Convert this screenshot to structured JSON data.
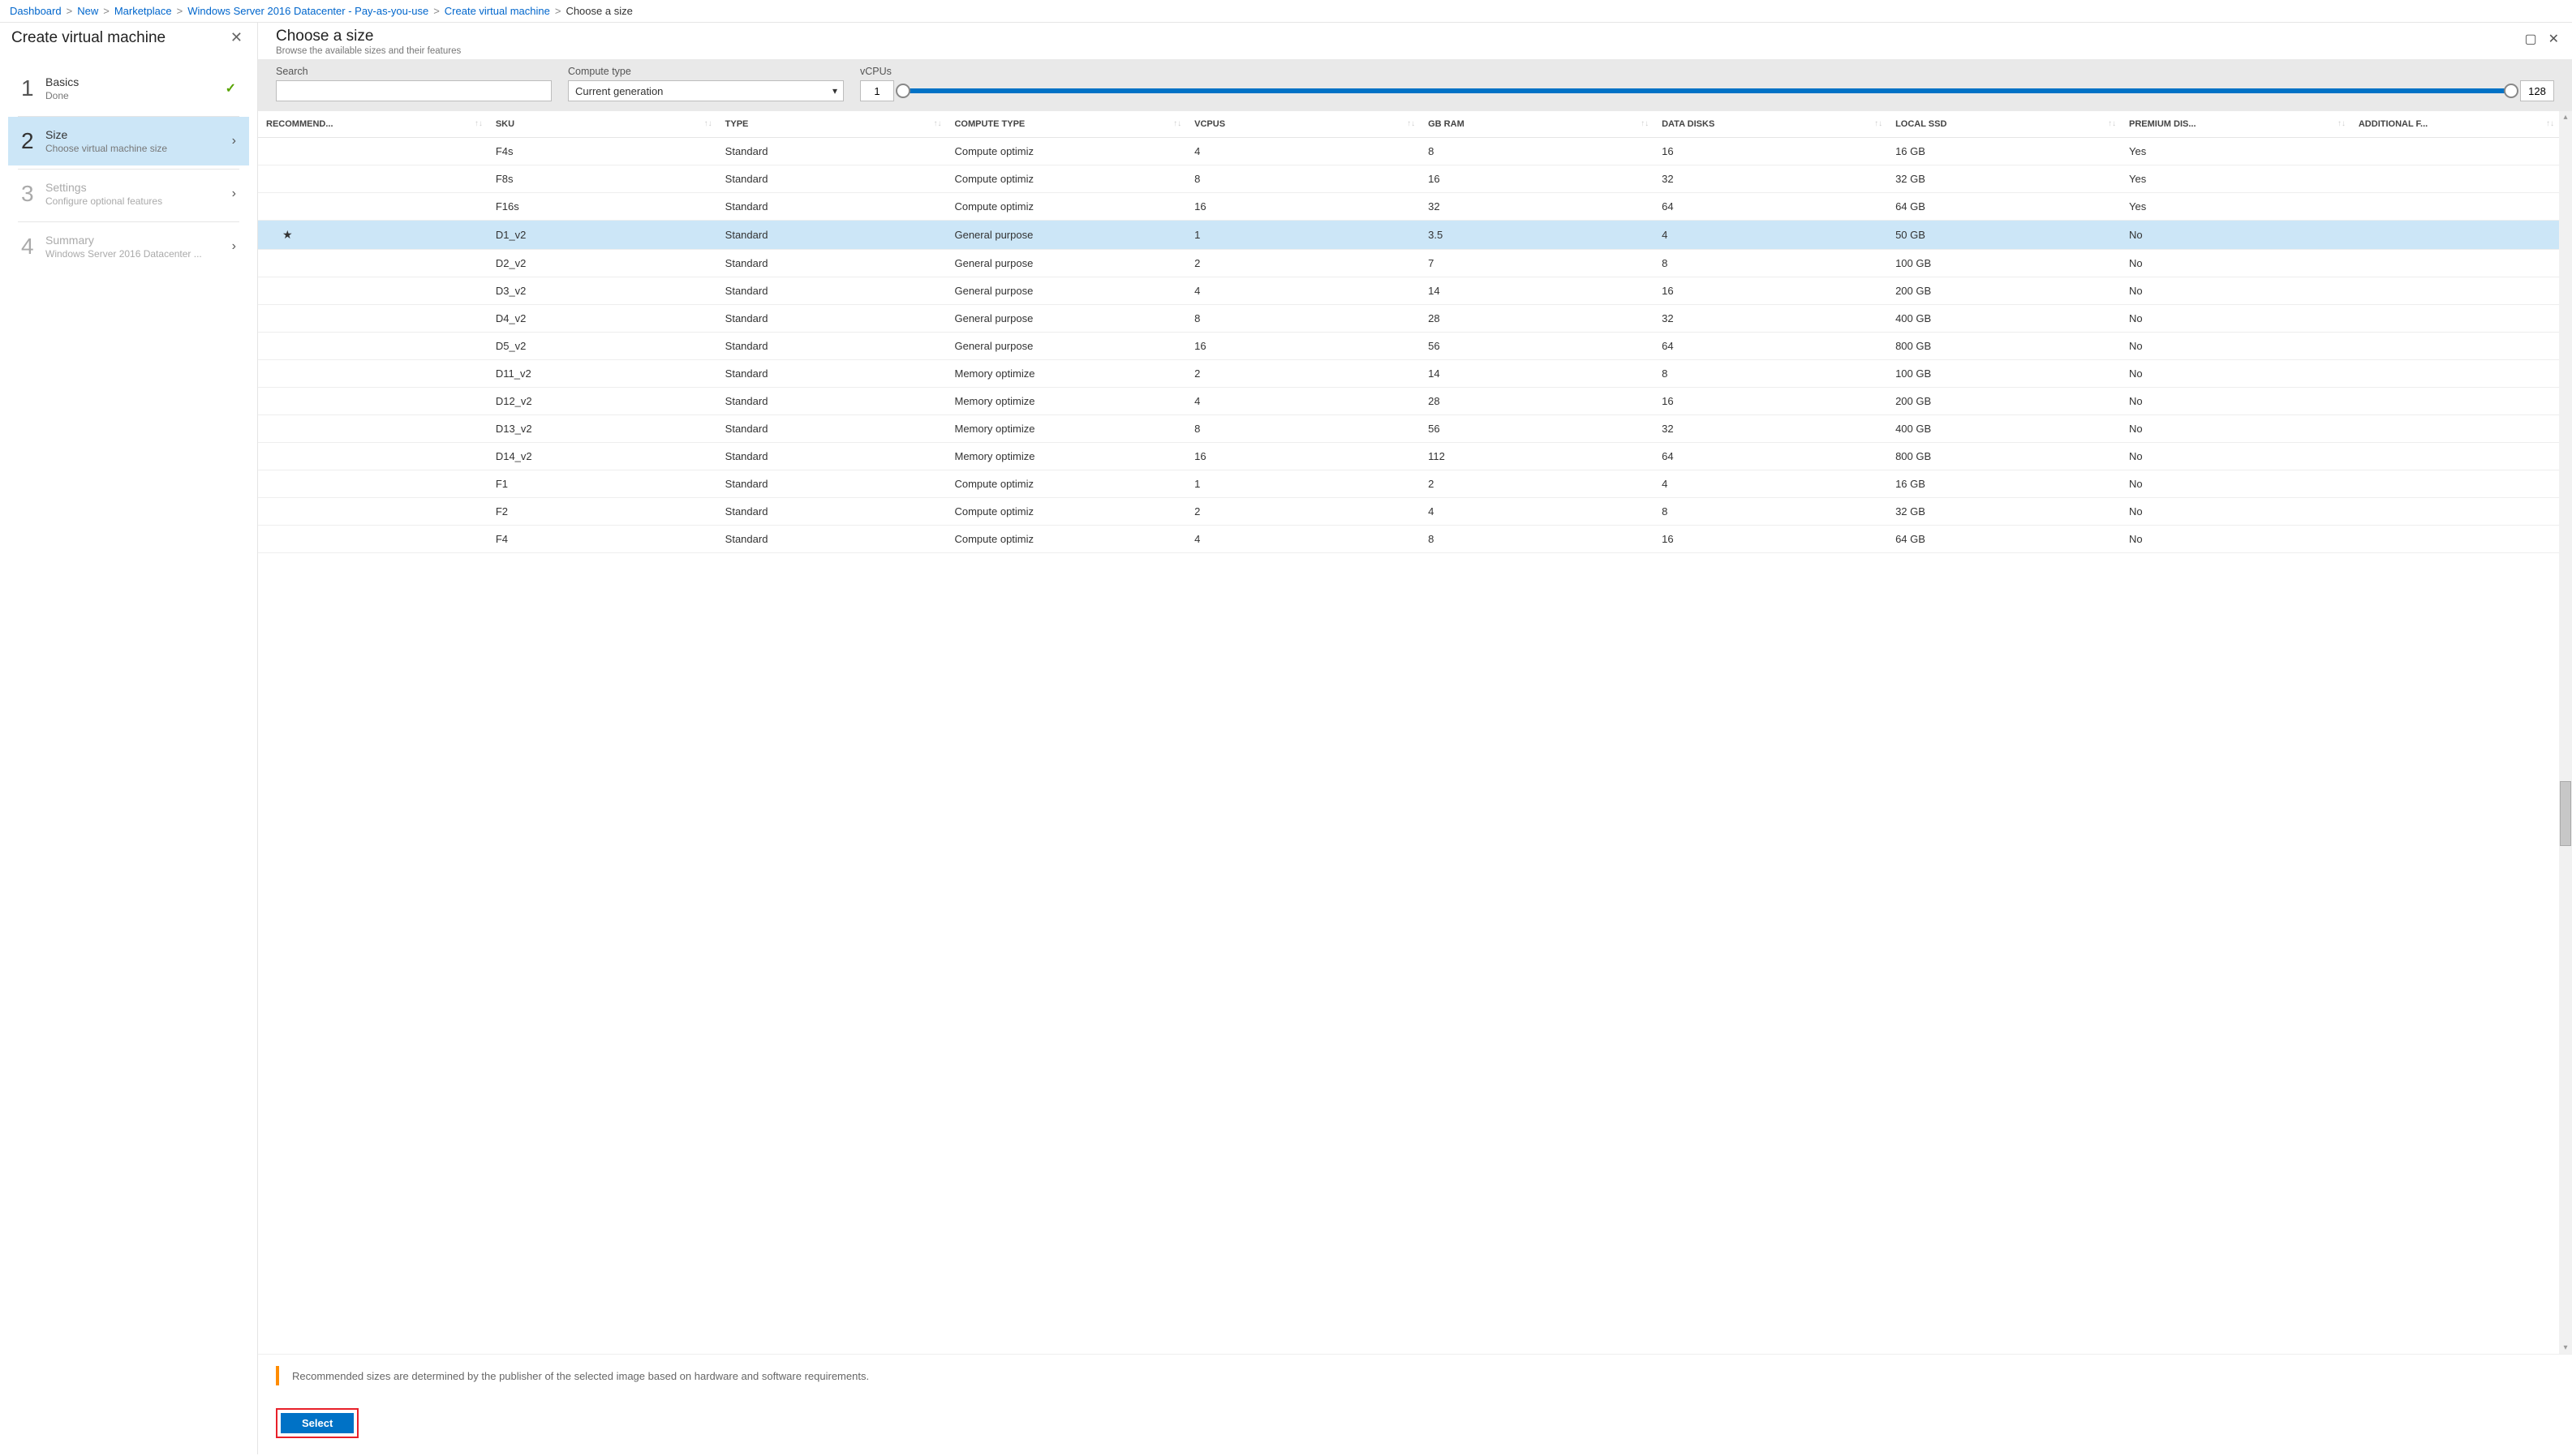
{
  "breadcrumb": {
    "items": [
      "Dashboard",
      "New",
      "Marketplace",
      "Windows Server 2016 Datacenter - Pay-as-you-use",
      "Create virtual machine"
    ],
    "current": "Choose a size"
  },
  "leftBlade": {
    "title": "Create virtual machine",
    "steps": [
      {
        "num": "1",
        "title": "Basics",
        "sub": "Done",
        "state": "done"
      },
      {
        "num": "2",
        "title": "Size",
        "sub": "Choose virtual machine size",
        "state": "active"
      },
      {
        "num": "3",
        "title": "Settings",
        "sub": "Configure optional features",
        "state": "disabled"
      },
      {
        "num": "4",
        "title": "Summary",
        "sub": "Windows Server 2016 Datacenter ...",
        "state": "disabled"
      }
    ]
  },
  "rightBlade": {
    "title": "Choose a size",
    "subtitle": "Browse the available sizes and their features",
    "filters": {
      "searchLabel": "Search",
      "searchValue": "",
      "computeTypeLabel": "Compute type",
      "computeTypeValue": "Current generation",
      "vcpusLabel": "vCPUs",
      "vcpusMin": "1",
      "vcpusMax": "128"
    },
    "columns": [
      "RECOMMEND...",
      "SKU",
      "TYPE",
      "COMPUTE TYPE",
      "VCPUS",
      "GB RAM",
      "DATA DISKS",
      "LOCAL SSD",
      "PREMIUM DIS...",
      "ADDITIONAL F..."
    ],
    "rows": [
      {
        "rec": "",
        "sku": "F4s",
        "type": "Standard",
        "ct": "Compute optimiz",
        "vcpus": "4",
        "ram": "8",
        "dd": "16",
        "ssd": "16 GB",
        "prem": "Yes"
      },
      {
        "rec": "",
        "sku": "F8s",
        "type": "Standard",
        "ct": "Compute optimiz",
        "vcpus": "8",
        "ram": "16",
        "dd": "32",
        "ssd": "32 GB",
        "prem": "Yes"
      },
      {
        "rec": "",
        "sku": "F16s",
        "type": "Standard",
        "ct": "Compute optimiz",
        "vcpus": "16",
        "ram": "32",
        "dd": "64",
        "ssd": "64 GB",
        "prem": "Yes"
      },
      {
        "rec": "★",
        "sku": "D1_v2",
        "type": "Standard",
        "ct": "General purpose",
        "vcpus": "1",
        "ram": "3.5",
        "dd": "4",
        "ssd": "50 GB",
        "prem": "No",
        "selected": true
      },
      {
        "rec": "",
        "sku": "D2_v2",
        "type": "Standard",
        "ct": "General purpose",
        "vcpus": "2",
        "ram": "7",
        "dd": "8",
        "ssd": "100 GB",
        "prem": "No"
      },
      {
        "rec": "",
        "sku": "D3_v2",
        "type": "Standard",
        "ct": "General purpose",
        "vcpus": "4",
        "ram": "14",
        "dd": "16",
        "ssd": "200 GB",
        "prem": "No"
      },
      {
        "rec": "",
        "sku": "D4_v2",
        "type": "Standard",
        "ct": "General purpose",
        "vcpus": "8",
        "ram": "28",
        "dd": "32",
        "ssd": "400 GB",
        "prem": "No"
      },
      {
        "rec": "",
        "sku": "D5_v2",
        "type": "Standard",
        "ct": "General purpose",
        "vcpus": "16",
        "ram": "56",
        "dd": "64",
        "ssd": "800 GB",
        "prem": "No"
      },
      {
        "rec": "",
        "sku": "D11_v2",
        "type": "Standard",
        "ct": "Memory optimize",
        "vcpus": "2",
        "ram": "14",
        "dd": "8",
        "ssd": "100 GB",
        "prem": "No"
      },
      {
        "rec": "",
        "sku": "D12_v2",
        "type": "Standard",
        "ct": "Memory optimize",
        "vcpus": "4",
        "ram": "28",
        "dd": "16",
        "ssd": "200 GB",
        "prem": "No"
      },
      {
        "rec": "",
        "sku": "D13_v2",
        "type": "Standard",
        "ct": "Memory optimize",
        "vcpus": "8",
        "ram": "56",
        "dd": "32",
        "ssd": "400 GB",
        "prem": "No"
      },
      {
        "rec": "",
        "sku": "D14_v2",
        "type": "Standard",
        "ct": "Memory optimize",
        "vcpus": "16",
        "ram": "112",
        "dd": "64",
        "ssd": "800 GB",
        "prem": "No"
      },
      {
        "rec": "",
        "sku": "F1",
        "type": "Standard",
        "ct": "Compute optimiz",
        "vcpus": "1",
        "ram": "2",
        "dd": "4",
        "ssd": "16 GB",
        "prem": "No"
      },
      {
        "rec": "",
        "sku": "F2",
        "type": "Standard",
        "ct": "Compute optimiz",
        "vcpus": "2",
        "ram": "4",
        "dd": "8",
        "ssd": "32 GB",
        "prem": "No"
      },
      {
        "rec": "",
        "sku": "F4",
        "type": "Standard",
        "ct": "Compute optimiz",
        "vcpus": "4",
        "ram": "8",
        "dd": "16",
        "ssd": "64 GB",
        "prem": "No"
      }
    ],
    "infoText": "Recommended sizes are determined by the publisher of the selected image based on hardware and software requirements.",
    "selectLabel": "Select"
  }
}
